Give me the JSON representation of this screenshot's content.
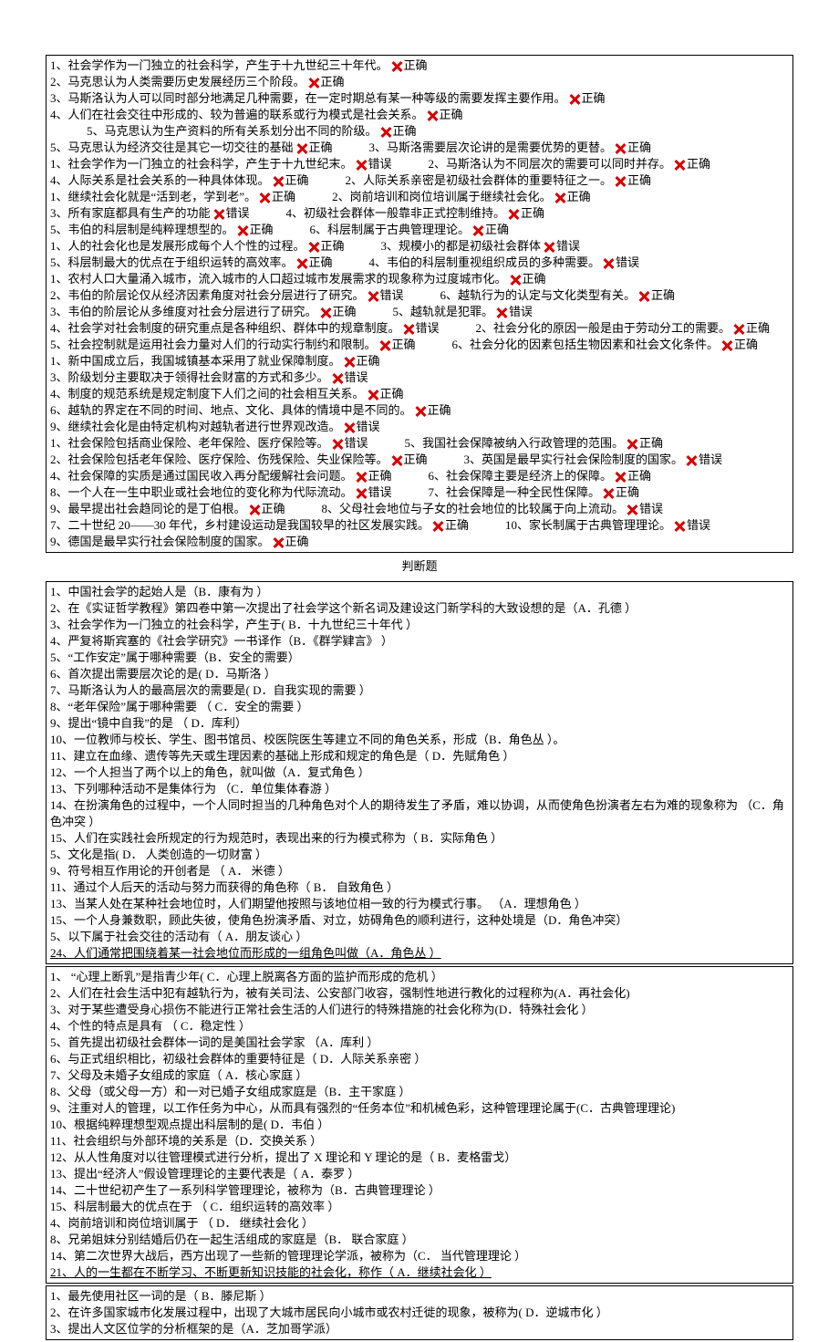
{
  "tf_rows": [
    [
      "1、社会学作为一门独立的社会科学，产生于十九世纪三十年代。|正确"
    ],
    [
      "2、马克思认为人类需要历史发展经历三个阶段。|正确"
    ],
    [
      "3、马斯洛认为人可以同时部分地满足几种需要，在一定时期总有某一种等级的需要发挥主要作用。|正确"
    ],
    [
      "4、人们在社会交往中形成的、较为普遍的联系或行为模式是社会关系。|正确",
      "5、马克思认为生产资料的所有关系划分出不同的阶级。|正确"
    ],
    [
      "5、马克思认为经济交往是其它一切交往的基础|正确",
      "3、马斯洛需要层次论讲的是需要优势的更替。|正确"
    ],
    [
      "1、社会学作为一门独立的社会科学，产生于十九世纪末。|错误",
      "2、马斯洛认为不同层次的需要可以同时并存。|正确"
    ],
    [
      "4、人际关系是社会关系的一种具体体现。|正确",
      "2、人际关系亲密是初级社会群体的重要特征之一。|正确"
    ],
    [
      "1、继续社会化就是“活到老，学到老”。|正确",
      "2、岗前培训和岗位培训属于继续社会化。|正确"
    ],
    [
      "3、所有家庭都具有生产的功能|错误",
      "4、初级社会群体一般靠非正式控制维持。|正确"
    ],
    [
      "5、韦伯的科层制是纯粹理想型的。|正确",
      "6、科层制属于古典管理理论。|正确"
    ],
    [
      "1、人的社会化也是发展形成每个人个性的过程。|正确",
      "3、规模小的都是初级社会群体|错误"
    ],
    [
      "5、科层制最大的优点在于组织运转的高效率。|正确",
      "4、韦伯的科层制重视组织成员的多种需要。|错误"
    ],
    [
      "1、农村人口大量涌入城市，流入城市的人口超过城市发展需求的现象称为过度城市化。|正确"
    ],
    [
      "2、韦伯的阶层论仅从经济因素角度对社会分层进行了研究。|错误",
      "6、越轨行为的认定与文化类型有关。|正确"
    ],
    [
      "3、韦伯的阶层论从多维度对社会分层进行了研究。|正确",
      "5、越轨就是犯罪。|错误"
    ],
    [
      "4、社会学对社会制度的研究重点是各种组织、群体中的规章制度。|错误",
      "2、社会分化的原因一般是由于劳动分工的需要。|正确"
    ],
    [
      "5、社会控制就是运用社会力量对人们的行动实行制约和限制。|正确",
      "6、社会分化的因素包括生物因素和社会文化条件。|正确"
    ],
    [
      "1、新中国成立后，我国城镇基本采用了就业保障制度。|正确"
    ],
    [
      "3、阶级划分主要取决于领得社会财富的方式和多少。|错误"
    ],
    [
      "4、制度的规范系统是规定制度下人们之间的社会相互关系。|正确"
    ],
    [
      "6、越轨的界定在不同的时间、地点、文化、具体的情境中是不同的。|正确"
    ],
    [
      "9、继续社会化是由特定机构对越轨者进行世界观改造。|错误"
    ],
    [
      "1、社会保险包括商业保险、老年保险、医疗保险等。|错误",
      "5、我国社会保障被纳入行政管理的范围。|正确"
    ],
    [
      "2、社会保险包括老年保险、医疗保险、伤残保险、失业保险等。|正确",
      "3、英国是最早实行社会保险制度的国家。|错误"
    ],
    [
      "4、社会保障的实质是通过国民收入再分配缓解社会问题。|正确",
      "6、社会保障主要是经济上的保障。|正确"
    ],
    [
      "8、一个人在一生中职业或社会地位的变化称为代际流动。|错误",
      "7、社会保障是一种全民性保障。|正确"
    ],
    [
      "9、最早提出社会趋同论的是丁伯根。|正确",
      "8、父母社会地位与子女的社会地位的比较属于向上流动。|错误"
    ],
    [
      "7、二十世纪 20——30 年代，乡村建设运动是我国较早的社区发展实践。|正确",
      "10、家长制属于古典管理理论。|错误"
    ],
    [
      "9、德国是最早实行社会保险制度的国家。|正确"
    ]
  ],
  "caption": "判断题",
  "mc1": [
    "1、中国社会学的起始人是（B．康有为  ）",
    "2、在《实证哲学教程》第四卷中第一次提出了社会学这个新名词及建设这门新学科的大致设想的是（A．孔德  ）",
    "3、社会学作为一门独立的社会科学，产生于( B．十九世纪三十年代  ）",
    "4、严复将斯宾塞的《社会学研究》一书译作（B．《群学肄言》  ）",
    "5、“工作安定”属于哪种需要（B．安全的需要）",
    "6、首次提出需要层次论的是( D．马斯洛  ）",
    "7、马斯洛认为人的最高层次的需要是( D．自我实现的需要   ）",
    "8、“老年保险”属于哪种需要  （ C．安全的需要  ）",
    "9、提出“镜中自我”的是 （ D．库利）",
    "10、一位教师与校长、学生、图书馆员、校医院医生等建立不同的角色关系，形成（B．角色丛   ）。",
    "11、建立在血缘、遗传等先天或生理因素的基础上形成和规定的角色是（ D．先赋角色   ）",
    "12、一个人担当了两个以上的角色，就叫做（A．复式角色 ）",
    "13、下列哪种活动不是集体行为  （C．单位集体春游  ）",
    "14、在扮演角色的过程中，一个人同时担当的几种角色对个人的期待发生了矛盾，难以协调，从而使角色扮演者左右为难的现象称为   （C．角色冲突 ）",
    "15、人们在实践社会所规定的行为规范时，表现出来的行为模式称为（  B．实际角色  ）",
    "5、文化是指( D．   人类创造的一切财富   ）",
    "9、符号相互作用论的开创者是 （ A．   米德    ）",
    "11、通过个人后天的活动与努力而获得的角色称（ B．   自致角色  ）",
    "13、当某人处在某种社会地位时，人们期望他按照与该地位相一致的行为模式行事。  （A．理想角色  ）",
    "15、一个人身兼数职，顾此失彼，使角色扮演矛盾、对立，妨碍角色的顺利进行，这种处境是（D．角色冲突）",
    "5、以下属于社会交往的活动有（ A．朋友谈心  ）",
    "24、人们通常把围绕着某一社会地位而形成的一组角色叫做（A．角色丛  ）"
  ],
  "mc2": [
    "1、 “心理上断乳”是指青少年( C．心理上脱离各方面的监护而形成的危机  ）",
    "2、人们在社会生活中犯有越轨行为，被有关司法、公安部门收容，强制性地进行教化的过程称为(A．再社会化)",
    "3、对于某些遭受身心损伤不能进行正常社会生活的人们进行的特殊措施的社会化称为(D．特殊社会化  ）",
    "4、个性的特点是具有 （ C．稳定性   ）",
    "5、首先提出初级社会群体一词的是美国社会学家  （A．库利  ）",
    "6、与正式组织相比，初级社会群体的重要特征是（ D．人际关系亲密  ）",
    "7、父母及未婚子女组成的家庭（ A．核心家庭   ）",
    "8、父母（或父母一方）和一对已婚子女组成家庭是（B．主干家庭   ）",
    "9、注重对人的管理，以工作任务为中心，从而具有强烈的“任务本位”和机械色彩，这种管理理论属于(C．古典管理理论)",
    "10、根据纯粹理想型观点提出科层制的是( D．韦伯   ）",
    "11、社会组织与外部环境的关系是（D．交换关系   ）",
    "12、从人性角度对以往管理模式进行分析，提出了 X 理论和 Y 理论的是（ B．麦格雷戈）",
    "13、提出“经济人”假设管理理论的主要代表是（ A．泰罗    ）",
    "14、二十世纪初产生了一系列科学管理理论，被称为（B．古典管理理论   ）",
    "15、科层制最大的优点在于  （   C．组织运转的高效率      ）",
    "4、岗前培训和岗位培训属于   （   D．    继续社会化       ）",
    "8、兄弟姐妹分别结婚后仍在一起生活组成的家庭是（B．   联合家庭   ）",
    "14、第二次世界大战后，西方出现了一些新的管理理论学派，被称为（C．   当代管理理论   ）",
    "21、人的一生都在不断学习、不断更新知识技能的社会化，称作（ A．继续社会化  ）"
  ],
  "mc3": [
    "1、最先使用社区一词的是（ B．滕尼斯  ）",
    "2、在许多国家城市化发展过程中，出现了大城市居民向小城市或农村迁徙的现象，被称为( D．逆城市化    ）",
    "3、提出人文区位学的分析框架的是（A．芝加哥学派）"
  ]
}
